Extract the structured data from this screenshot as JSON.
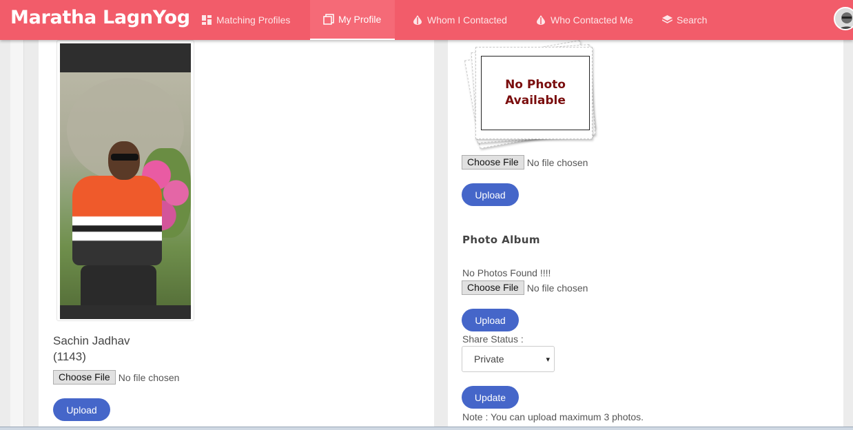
{
  "header": {
    "brand": "Maratha LagnYog",
    "nav": [
      {
        "label": "Matching Profiles",
        "icon": "dashboard-icon"
      },
      {
        "label": "My Profile",
        "icon": "copy-icon",
        "active": true
      },
      {
        "label": "Whom I Contacted",
        "icon": "drop-icon"
      },
      {
        "label": "Who Contacted Me",
        "icon": "drop-icon"
      },
      {
        "label": "Search",
        "icon": "layers-icon"
      }
    ]
  },
  "left": {
    "name": "Sachin Jadhav",
    "id": "(1143)",
    "file_button": "Choose File",
    "file_status": "No file chosen",
    "upload_label": "Upload"
  },
  "right": {
    "no_photo_line1": "No Photo",
    "no_photo_line2": "Available",
    "file_button": "Choose File",
    "file_status": "No file chosen",
    "upload_label": "Upload",
    "album_title": "Photo Album",
    "album_empty": "No Photos Found !!!!",
    "album_file_button": "Choose File",
    "album_file_status": "No file chosen",
    "album_upload_label": "Upload",
    "share_status_label": "Share Status :",
    "share_status_value": "Private",
    "update_label": "Update",
    "note": "Note : You can upload maximum 3 photos."
  },
  "colors": {
    "navbar": "#f25c6a",
    "button": "#4566c9",
    "no_photo_text": "#7a0d0d"
  }
}
